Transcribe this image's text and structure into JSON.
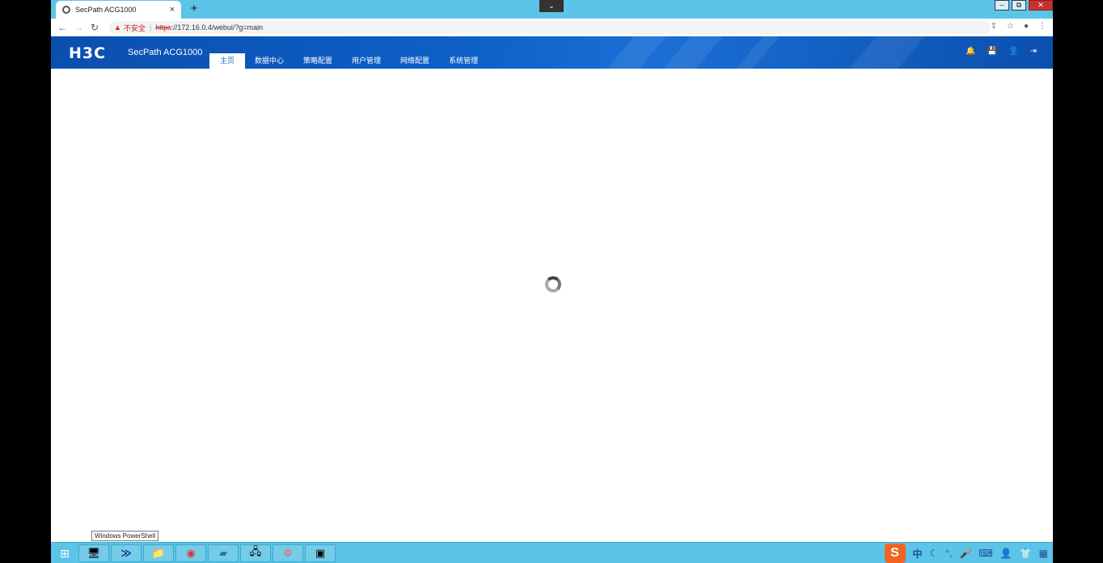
{
  "browser": {
    "tab_title": "SecPath ACG1000",
    "tab_close": "×",
    "new_tab": "+",
    "tab_search": "⌄",
    "win_min": "–",
    "win_restore": "⧉",
    "win_close": "✕",
    "back": "←",
    "forward": "→",
    "reload": "↻",
    "security_warning": "▲",
    "insecure_label": "不安全",
    "url_scheme": "https",
    "url_rest": "://172.16.0.4/webui/?g=main",
    "share_icon": "⇪",
    "bookmark_icon": "☆",
    "profile_icon": "●",
    "menu_icon": "⋮"
  },
  "app": {
    "logo": "H3C",
    "product": "SecPath ACG1000",
    "nav": [
      "主页",
      "数据中心",
      "策略配置",
      "用户管理",
      "网络配置",
      "系统管理"
    ],
    "active_nav": 0,
    "header_icons": [
      "bell-icon",
      "save-icon",
      "user-icon",
      "logout-icon"
    ],
    "header_glyphs": [
      "🔔",
      "💾",
      "👤",
      "⇥"
    ]
  },
  "tooltip": "Windows PowerShell",
  "taskbar": {
    "start": "⊞",
    "items": [
      {
        "name": "server-manager",
        "glyph": "🖥"
      },
      {
        "name": "powershell",
        "glyph": "≫"
      },
      {
        "name": "file-explorer",
        "glyph": "📁"
      },
      {
        "name": "chrome",
        "glyph": "◉"
      },
      {
        "name": "app-5",
        "glyph": "▰"
      },
      {
        "name": "remote-desktop",
        "glyph": "🖧"
      },
      {
        "name": "app-7",
        "glyph": "⚙"
      },
      {
        "name": "app-8",
        "glyph": "▣"
      }
    ],
    "tray": {
      "ime": "S",
      "lang": "中",
      "moon": "☾",
      "punct": "°,",
      "mic": "🎤",
      "keyboard": "⌨",
      "user": "👤",
      "shirt": "👕",
      "grid": "▦"
    }
  }
}
